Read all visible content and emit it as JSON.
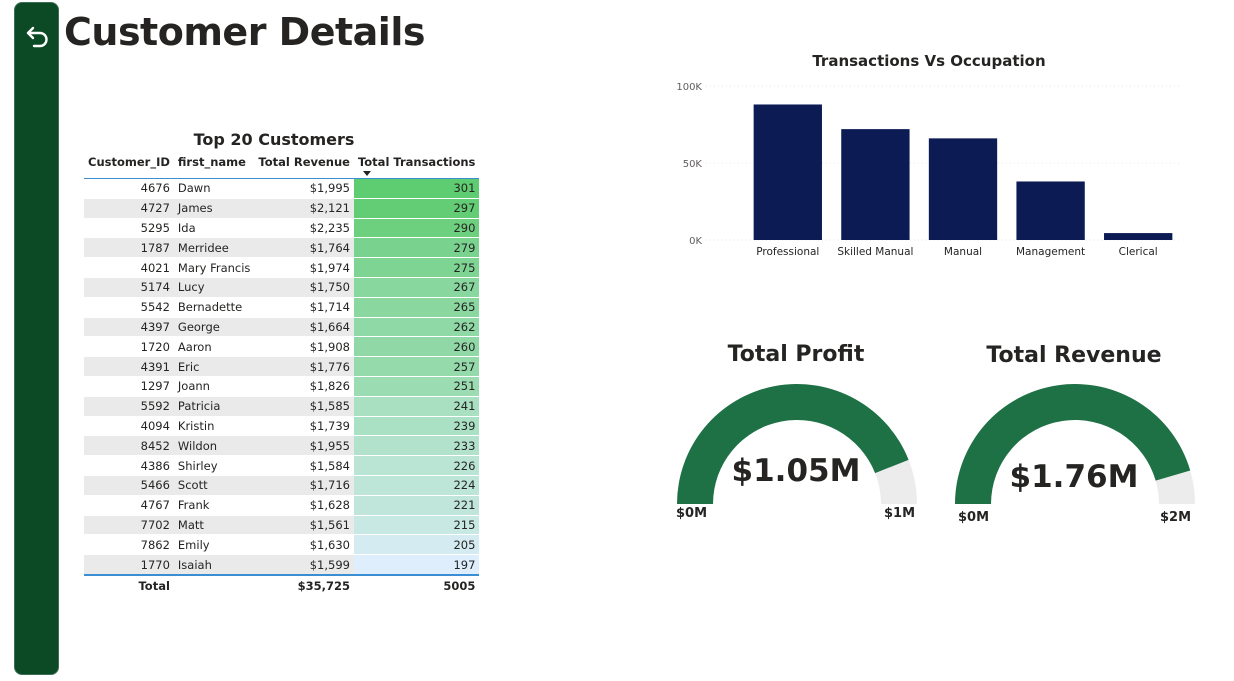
{
  "page": {
    "title": "Customer Details"
  },
  "icons": {
    "back": "back-arrow-icon",
    "sort": "sort-descending-icon"
  },
  "colors": {
    "sidebar": "#0b4a24",
    "bar": "#0d1b55",
    "gauge_fill": "#1e7145",
    "gauge_bg": "#ececec",
    "accent_line": "#3b8ed4"
  },
  "table": {
    "title": "Top 20 Customers",
    "columns": [
      "Customer_ID",
      "first_name",
      "Total Revenue",
      "Total Transactions"
    ],
    "sorted_column": "Total Transactions",
    "rows": [
      [
        "4676",
        "Dawn",
        "$1,995",
        "301"
      ],
      [
        "4727",
        "James",
        "$2,121",
        "297"
      ],
      [
        "5295",
        "Ida",
        "$2,235",
        "290"
      ],
      [
        "1787",
        "Merridee",
        "$1,764",
        "279"
      ],
      [
        "4021",
        "Mary Francis",
        "$1,974",
        "275"
      ],
      [
        "5174",
        "Lucy",
        "$1,750",
        "267"
      ],
      [
        "5542",
        "Bernadette",
        "$1,714",
        "265"
      ],
      [
        "4397",
        "George",
        "$1,664",
        "262"
      ],
      [
        "1720",
        "Aaron",
        "$1,908",
        "260"
      ],
      [
        "4391",
        "Eric",
        "$1,776",
        "257"
      ],
      [
        "1297",
        "Joann",
        "$1,826",
        "251"
      ],
      [
        "5592",
        "Patricia",
        "$1,585",
        "241"
      ],
      [
        "4094",
        "Kristin",
        "$1,739",
        "239"
      ],
      [
        "8452",
        "Wildon",
        "$1,955",
        "233"
      ],
      [
        "4386",
        "Shirley",
        "$1,584",
        "226"
      ],
      [
        "5466",
        "Scott",
        "$1,716",
        "224"
      ],
      [
        "4767",
        "Frank",
        "$1,628",
        "221"
      ],
      [
        "7702",
        "Matt",
        "$1,561",
        "215"
      ],
      [
        "7862",
        "Emily",
        "$1,630",
        "205"
      ],
      [
        "1770",
        "Isaiah",
        "$1,599",
        "197"
      ]
    ],
    "total": {
      "label": "Total",
      "revenue": "$35,725",
      "transactions": "5005"
    }
  },
  "chart_data": {
    "type": "bar",
    "title": "Transactions Vs Occupation",
    "categories": [
      "Professional",
      "Skilled Manual",
      "Manual",
      "Management",
      "Clerical"
    ],
    "values": [
      88000,
      72000,
      66000,
      38000,
      4500
    ],
    "ylim": [
      0,
      100000
    ],
    "yticks": [
      0,
      50000,
      100000
    ],
    "ytick_labels": [
      "0K",
      "50K",
      "100K"
    ],
    "xlabel": "",
    "ylabel": "",
    "grid": true
  },
  "gauges": [
    {
      "title": "Total Profit",
      "value_label": "$1.05M",
      "min_label": "$0M",
      "max_label": "$1M",
      "fill_fraction": 0.88
    },
    {
      "title": "Total Revenue",
      "value_label": "$1.76M",
      "min_label": "$0M",
      "max_label": "$2M",
      "fill_fraction": 0.91
    }
  ]
}
